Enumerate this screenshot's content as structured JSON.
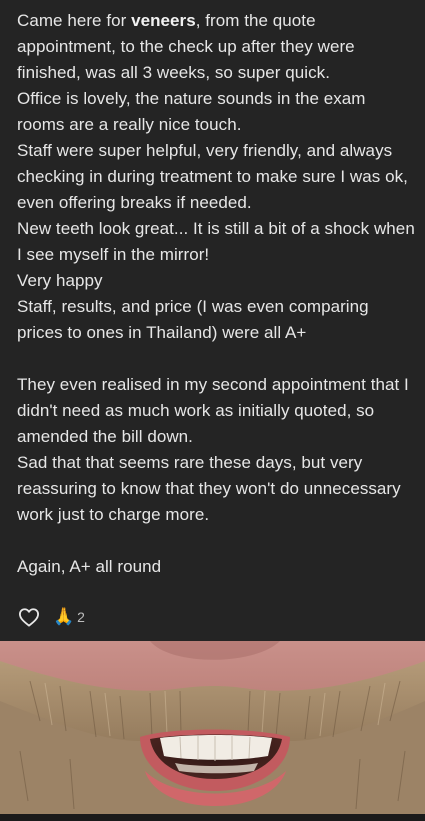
{
  "review": {
    "line1_pre": "Came here for ",
    "line1_bold": "veneers",
    "line1_post": ", from the quote appointment, to the check up after they were finished, was all 3 weeks, so super quick.",
    "line2": "Office is lovely, the nature sounds in the exam rooms are a really nice touch.",
    "line3": "Staff were super helpful, very friendly, and always checking in during treatment to make sure I was ok, even offering breaks if needed.",
    "line4": "New teeth look great... It is still a bit of a shock when I see myself in the mirror!",
    "line5": "Very happy",
    "line6": "Staff, results, and price (I was even comparing prices to ones in Thailand) were all A+",
    "line7": "They even realised in my second appointment that I didn't need as much work as initially quoted, so amended the bill down.",
    "line8": "Sad that that seems rare these days, but very reassuring to know that they won't do unnecessary work just to charge more.",
    "line9": "Again, A+ all round"
  },
  "reactions": {
    "heart_icon": "heart-outline-icon",
    "pray_emoji": "🙏",
    "pray_count": "2"
  },
  "colors": {
    "background": "#242424",
    "text": "#e6e6e6"
  }
}
